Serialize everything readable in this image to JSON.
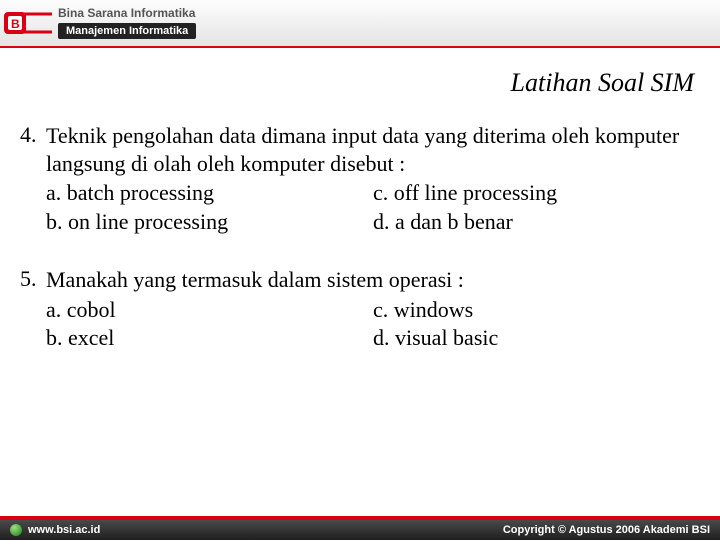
{
  "header": {
    "institution": "Bina Sarana Informatika",
    "program": "Manajemen Informatika"
  },
  "title": "Latihan Soal SIM",
  "questions": [
    {
      "number": "4.",
      "stem": "Teknik pengolahan data dimana input data yang diterima oleh komputer langsung di olah oleh komputer disebut :",
      "options": {
        "a": "a. batch processing",
        "b": "b. on line processing",
        "c": "c. off line processing",
        "d": "d. a dan b benar"
      }
    },
    {
      "number": "5.",
      "stem": "Manakah yang termasuk dalam sistem operasi :",
      "options": {
        "a": "a. cobol",
        "b": "b. excel",
        "c": "c. windows",
        "d": "d. visual basic"
      }
    }
  ],
  "footer": {
    "url": "www.bsi.ac.id",
    "copyright": "Copyright © Agustus 2006 Akademi BSI"
  }
}
